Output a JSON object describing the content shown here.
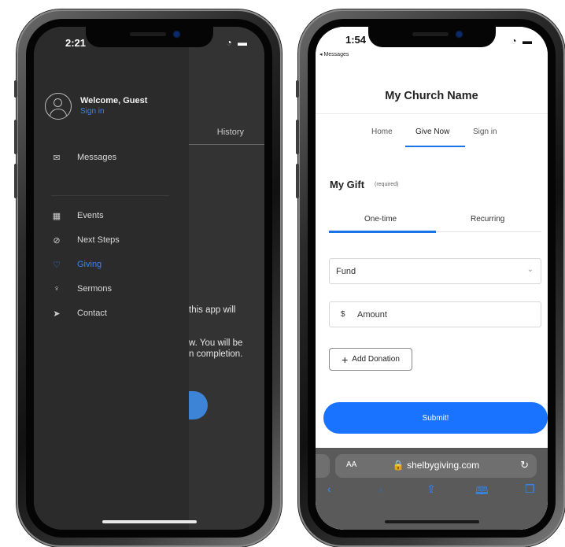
{
  "phone1": {
    "status_time": "2:21",
    "status_icons": "≡ ▬",
    "behind": {
      "history_tab": "History",
      "text_line1": "this app will",
      "text_line2": "w. You will be",
      "text_line3": "n completion."
    },
    "drawer": {
      "welcome": "Welcome, Guest",
      "sign_in": "Sign in",
      "items": [
        {
          "icon": "envelope-icon",
          "glyph": "✉",
          "label": "Messages"
        },
        {
          "icon": "calendar-icon",
          "glyph": "▦",
          "label": "Events"
        },
        {
          "icon": "compass-icon",
          "glyph": "⊘",
          "label": "Next Steps"
        },
        {
          "icon": "heart-icon",
          "glyph": "♡",
          "label": "Giving",
          "active": true
        },
        {
          "icon": "microphone-icon",
          "glyph": "♀",
          "label": "Sermons"
        },
        {
          "icon": "paper-plane-icon",
          "glyph": "➤",
          "label": "Contact"
        }
      ]
    },
    "colors": {
      "accent": "#3b82f6",
      "drawer_bg": "#2b2b2b"
    }
  },
  "phone2": {
    "status_time": "1:54",
    "back_label": "◂ Messages",
    "church_name": "My Church Name",
    "tabs": [
      {
        "label": "Home"
      },
      {
        "label": "Give Now",
        "active": true
      },
      {
        "label": "Sign in"
      }
    ],
    "gift": {
      "title": "My Gift",
      "required": "(required)",
      "frequency": [
        "One-time",
        "Recurring"
      ],
      "selected_frequency": "One-time",
      "fund_placeholder": "Fund",
      "currency": "$",
      "amount_placeholder": "Amount",
      "add_donation": "Add Donation",
      "submit": "Submit!"
    },
    "browser": {
      "aa": "AA",
      "url": "🔒 shelbygiving.com",
      "reload": "↻",
      "toolbar": [
        "back-icon",
        "forward-icon",
        "share-icon",
        "bookmarks-icon",
        "tabs-icon"
      ]
    },
    "colors": {
      "accent": "#1a73ff"
    }
  }
}
